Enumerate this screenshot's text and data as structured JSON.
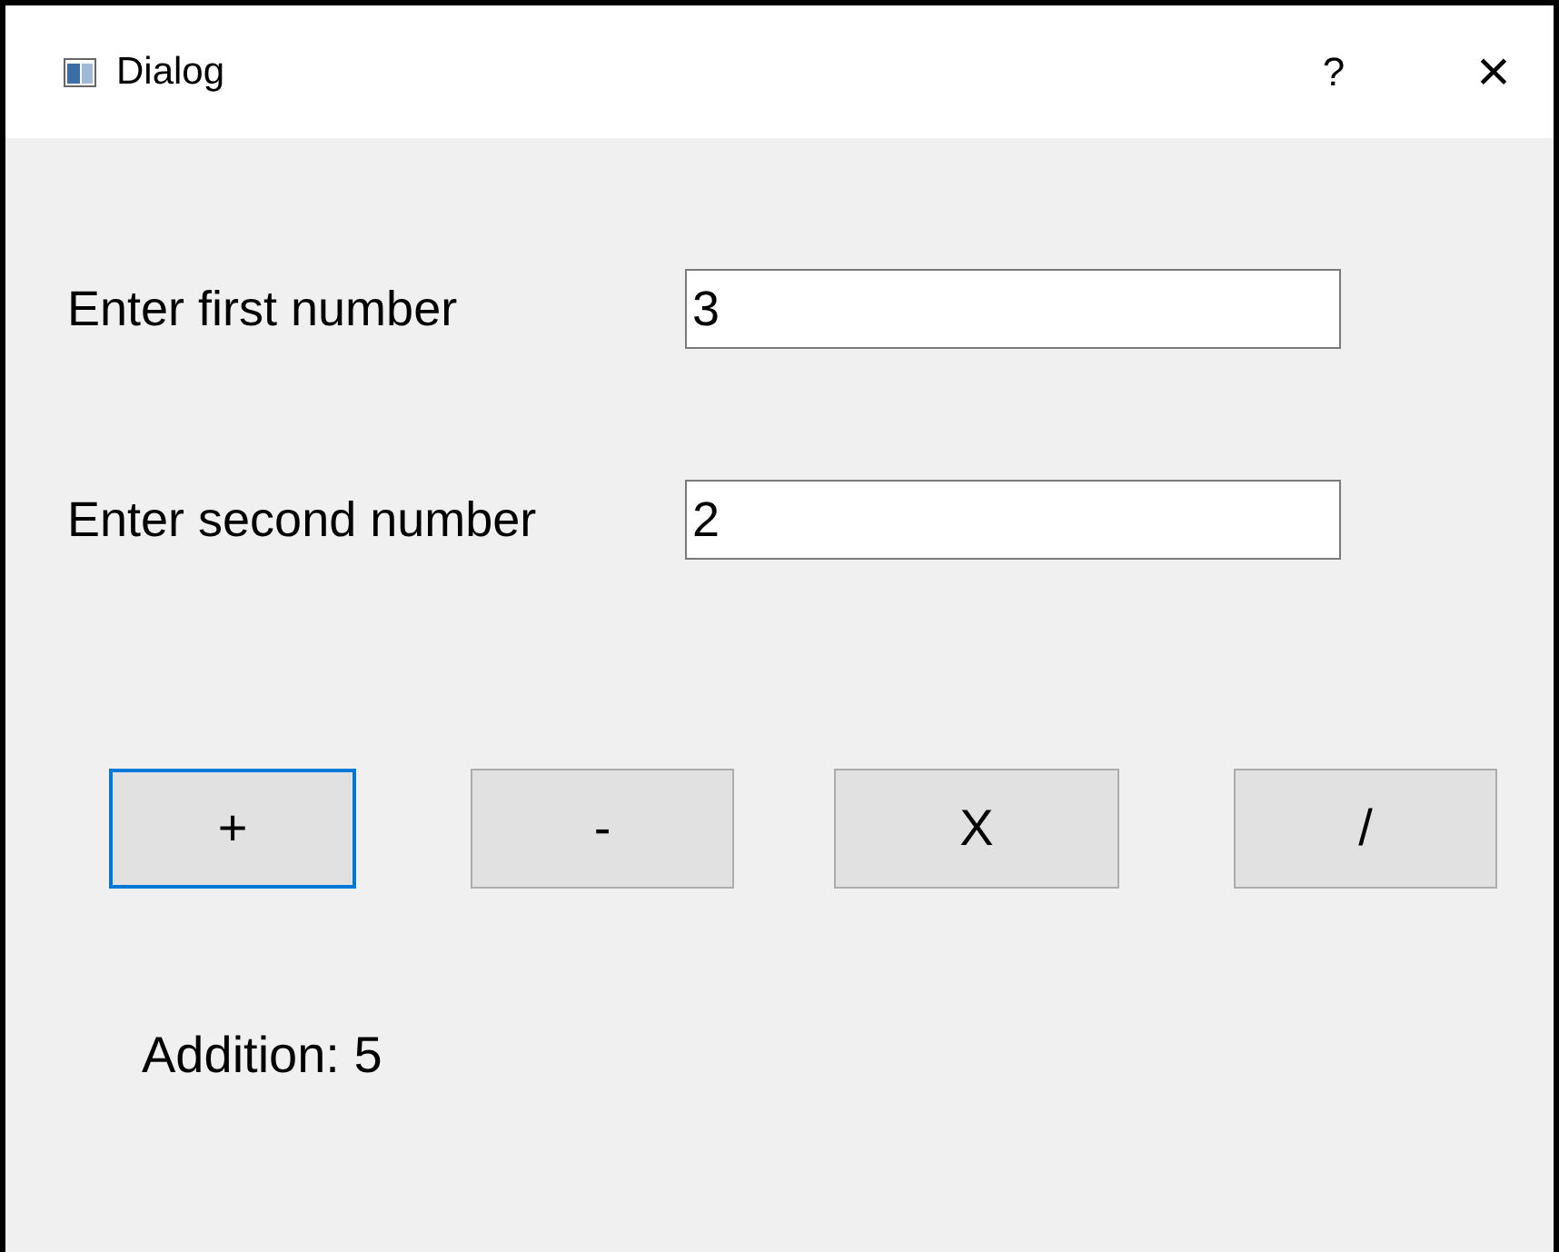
{
  "window": {
    "title": "Dialog",
    "help": "?",
    "close": "×"
  },
  "fields": [
    {
      "label": "Enter first number",
      "value": "3"
    },
    {
      "label": "Enter second number",
      "value": "2"
    }
  ],
  "buttons": [
    {
      "label": "+",
      "focused": true
    },
    {
      "label": "-",
      "focused": false
    },
    {
      "label": "X",
      "focused": false
    },
    {
      "label": "/",
      "focused": false
    }
  ],
  "result": "Addition: 5"
}
